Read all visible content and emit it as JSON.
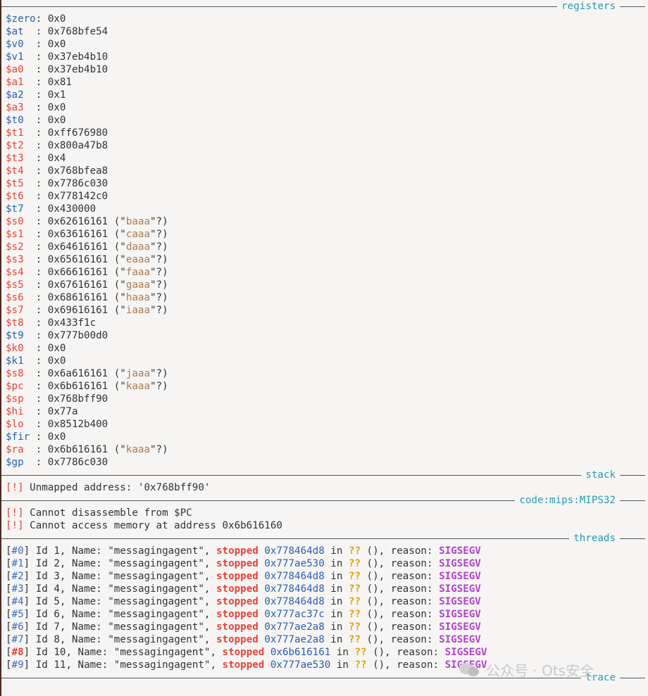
{
  "sections": {
    "registers": "registers",
    "stack": "stack",
    "code": "code:mips:MIPS32",
    "threads": "threads",
    "trace": "trace"
  },
  "registers": [
    {
      "name": "$zero",
      "sep": ": ",
      "value": "0x0",
      "color": "blue"
    },
    {
      "name": "$at",
      "sep": "  : ",
      "value": "0x768bfe54",
      "color": "blue"
    },
    {
      "name": "$v0",
      "sep": "  : ",
      "value": "0x0",
      "color": "blue"
    },
    {
      "name": "$v1",
      "sep": "  : ",
      "value": "0x37eb4b10",
      "color": "blue"
    },
    {
      "name": "$a0",
      "sep": "  : ",
      "value": "0x37eb4b10",
      "color": "red"
    },
    {
      "name": "$a1",
      "sep": "  : ",
      "value": "0x81",
      "color": "red"
    },
    {
      "name": "$a2",
      "sep": "  : ",
      "value": "0x1",
      "color": "blue"
    },
    {
      "name": "$a3",
      "sep": "  : ",
      "value": "0x0",
      "color": "red"
    },
    {
      "name": "$t0",
      "sep": "  : ",
      "value": "0x0",
      "color": "blue"
    },
    {
      "name": "$t1",
      "sep": "  : ",
      "value": "0xff676980",
      "color": "red"
    },
    {
      "name": "$t2",
      "sep": "  : ",
      "value": "0x800a47b8",
      "color": "red"
    },
    {
      "name": "$t3",
      "sep": "  : ",
      "value": "0x4",
      "color": "red"
    },
    {
      "name": "$t4",
      "sep": "  : ",
      "value": "0x768bfea8",
      "color": "red"
    },
    {
      "name": "$t5",
      "sep": "  : ",
      "value": "0x7786c030",
      "color": "red"
    },
    {
      "name": "$t6",
      "sep": "  : ",
      "value": "0x778142c0",
      "color": "red"
    },
    {
      "name": "$t7",
      "sep": "  : ",
      "value": "0x430000",
      "color": "blue"
    },
    {
      "name": "$s0",
      "sep": "  : ",
      "value": "0x62616161",
      "str": "baaa",
      "color": "red"
    },
    {
      "name": "$s1",
      "sep": "  : ",
      "value": "0x63616161",
      "str": "caaa",
      "color": "red"
    },
    {
      "name": "$s2",
      "sep": "  : ",
      "value": "0x64616161",
      "str": "daaa",
      "color": "red"
    },
    {
      "name": "$s3",
      "sep": "  : ",
      "value": "0x65616161",
      "str": "eaaa",
      "color": "red"
    },
    {
      "name": "$s4",
      "sep": "  : ",
      "value": "0x66616161",
      "str": "faaa",
      "color": "red"
    },
    {
      "name": "$s5",
      "sep": "  : ",
      "value": "0x67616161",
      "str": "gaaa",
      "color": "red"
    },
    {
      "name": "$s6",
      "sep": "  : ",
      "value": "0x68616161",
      "str": "haaa",
      "color": "red"
    },
    {
      "name": "$s7",
      "sep": "  : ",
      "value": "0x69616161",
      "str": "iaaa",
      "color": "red"
    },
    {
      "name": "$t8",
      "sep": "  : ",
      "value": "0x433f1c",
      "color": "red"
    },
    {
      "name": "$t9",
      "sep": "  : ",
      "value": "0x777b00d0",
      "color": "blue"
    },
    {
      "name": "$k0",
      "sep": "  : ",
      "value": "0x0",
      "color": "red"
    },
    {
      "name": "$k1",
      "sep": "  : ",
      "value": "0x0",
      "color": "blue"
    },
    {
      "name": "$s8",
      "sep": "  : ",
      "value": "0x6a616161",
      "str": "jaaa",
      "color": "red"
    },
    {
      "name": "$pc",
      "sep": "  : ",
      "value": "0x6b616161",
      "str": "kaaa",
      "color": "red"
    },
    {
      "name": "$sp",
      "sep": "  : ",
      "value": "0x768bff90",
      "color": "red"
    },
    {
      "name": "$hi",
      "sep": "  : ",
      "value": "0x77a",
      "color": "red"
    },
    {
      "name": "$lo",
      "sep": "  : ",
      "value": "0x8512b400",
      "color": "red"
    },
    {
      "name": "$fir",
      "sep": " : ",
      "value": "0x0",
      "color": "blue"
    },
    {
      "name": "$ra",
      "sep": "  : ",
      "value": "0x6b616161",
      "str": "kaaa",
      "color": "red"
    },
    {
      "name": "$gp",
      "sep": "  : ",
      "value": "0x7786c030",
      "color": "blue"
    }
  ],
  "stack": {
    "bang": "[!]",
    "message": "Unmapped address: '0x768bff90'"
  },
  "code": [
    {
      "bang": "[!]",
      "message": "Cannot disassemble from $PC"
    },
    {
      "bang": "[!]",
      "message": "Cannot access memory at address 0x6b616160"
    }
  ],
  "threads": [
    {
      "frame": "#0",
      "id_text": "Id 1, Name: \"messagingagent\", ",
      "state": "stopped",
      "addr": "0x778464d8",
      "in": " in ",
      "fn": "??",
      "reason_text": " (), reason: ",
      "signal": "SIGSEGV",
      "selected": false
    },
    {
      "frame": "#1",
      "id_text": "Id 2, Name: \"messagingagent\", ",
      "state": "stopped",
      "addr": "0x777ae530",
      "in": " in ",
      "fn": "??",
      "reason_text": " (), reason: ",
      "signal": "SIGSEGV",
      "selected": false
    },
    {
      "frame": "#2",
      "id_text": "Id 3, Name: \"messagingagent\", ",
      "state": "stopped",
      "addr": "0x778464d8",
      "in": " in ",
      "fn": "??",
      "reason_text": " (), reason: ",
      "signal": "SIGSEGV",
      "selected": false
    },
    {
      "frame": "#3",
      "id_text": "Id 4, Name: \"messagingagent\", ",
      "state": "stopped",
      "addr": "0x778464d8",
      "in": " in ",
      "fn": "??",
      "reason_text": " (), reason: ",
      "signal": "SIGSEGV",
      "selected": false
    },
    {
      "frame": "#4",
      "id_text": "Id 5, Name: \"messagingagent\", ",
      "state": "stopped",
      "addr": "0x778464d8",
      "in": " in ",
      "fn": "??",
      "reason_text": " (), reason: ",
      "signal": "SIGSEGV",
      "selected": false
    },
    {
      "frame": "#5",
      "id_text": "Id 6, Name: \"messagingagent\", ",
      "state": "stopped",
      "addr": "0x777ac37c",
      "in": " in ",
      "fn": "??",
      "reason_text": " (), reason: ",
      "signal": "SIGSEGV",
      "selected": false
    },
    {
      "frame": "#6",
      "id_text": "Id 7, Name: \"messagingagent\", ",
      "state": "stopped",
      "addr": "0x777ae2a8",
      "in": " in ",
      "fn": "??",
      "reason_text": " (), reason: ",
      "signal": "SIGSEGV",
      "selected": false
    },
    {
      "frame": "#7",
      "id_text": "Id 8, Name: \"messagingagent\", ",
      "state": "stopped",
      "addr": "0x777ae2a8",
      "in": " in ",
      "fn": "??",
      "reason_text": " (), reason: ",
      "signal": "SIGSEGV",
      "selected": false
    },
    {
      "frame": "#8",
      "id_text": "Id 10, Name: \"messagingagent\", ",
      "state": "stopped",
      "addr": "0x6b616161",
      "in": " in ",
      "fn": "??",
      "reason_text": " (), reason: ",
      "signal": "SIGSEGV",
      "selected": true
    },
    {
      "frame": "#9",
      "id_text": "Id 11, Name: \"messagingagent\", ",
      "state": "stopped",
      "addr": "0x777ae530",
      "in": " in ",
      "fn": "??",
      "reason_text": " (), reason: ",
      "signal": "SIGSEGV",
      "selected": false
    }
  ],
  "watermark": "公众号 · Ots安全",
  "colors": {
    "background": "#f6f5f4",
    "header": "#2a9bb0",
    "reg_blue": "#2b5fa8",
    "reg_red": "#e0443a",
    "string": "#a97a4f",
    "signal": "#b044c8",
    "unknown": "#e0a100"
  },
  "icons": {
    "watermark": "wechat-icon"
  }
}
